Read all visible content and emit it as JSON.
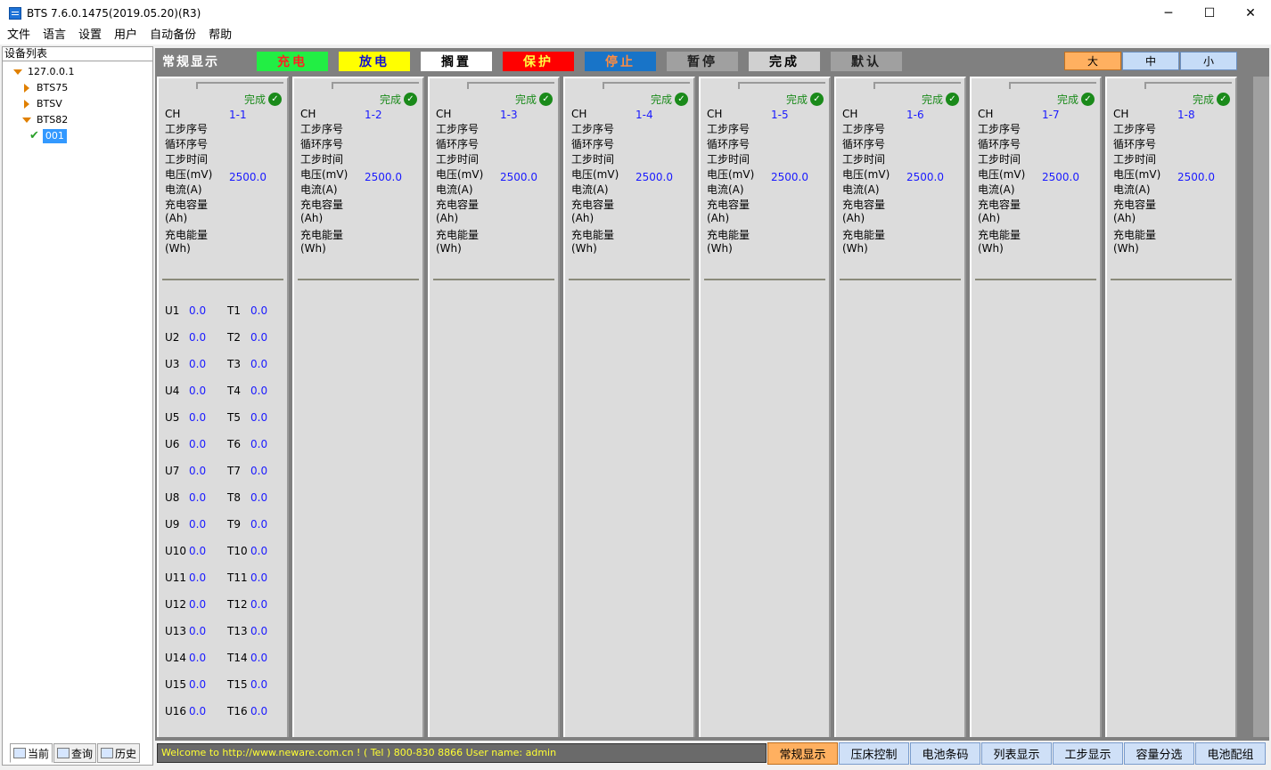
{
  "window": {
    "title": "BTS 7.6.0.1475(2019.05.20)(R3)",
    "minimize": "─",
    "maximize": "☐",
    "close": "✕"
  },
  "menu": [
    "文件",
    "语言",
    "设置",
    "用户",
    "自动备份",
    "帮助"
  ],
  "device_tree": {
    "header": "设备列表",
    "root": "127.0.0.1",
    "children": [
      "BTS75",
      "BTSV",
      "BTS82"
    ],
    "leaf": "001"
  },
  "left_tabs": [
    "当前",
    "查询",
    "历史"
  ],
  "legend": {
    "title": "常规显示",
    "items": [
      {
        "label": "充电",
        "bg": "#22ee44",
        "fg": "#ff2020"
      },
      {
        "label": "放电",
        "bg": "#ffff00",
        "fg": "#1010d0"
      },
      {
        "label": "搁置",
        "bg": "#ffffff",
        "fg": "#000000"
      },
      {
        "label": "保护",
        "bg": "#ff0000",
        "fg": "#ffff40"
      },
      {
        "label": "停止",
        "bg": "#1874c8",
        "fg": "#ff8c40"
      },
      {
        "label": "暂停",
        "bg": "#a0a0a0",
        "fg": "#202020"
      },
      {
        "label": "完成",
        "bg": "#d0d0d0",
        "fg": "#000000"
      },
      {
        "label": "默认",
        "bg": "#a0a0a0",
        "fg": "#202020"
      }
    ]
  },
  "size_buttons": {
    "large": "大",
    "medium": "中",
    "small": "小"
  },
  "channel_labels": {
    "status": "完成",
    "ch": "CH",
    "step_no": "工步序号",
    "cycle_no": "循环序号",
    "step_time": "工步时间",
    "voltage": "电压(mV)",
    "current": "电流(A)",
    "charge_cap": "充电容量",
    "charge_cap_unit": "(Ah)",
    "charge_energy": "充电能量",
    "charge_energy_unit": "(Wh)"
  },
  "channels": [
    {
      "id": "1-1",
      "voltage": "2500.0"
    },
    {
      "id": "1-2",
      "voltage": "2500.0"
    },
    {
      "id": "1-3",
      "voltage": "2500.0"
    },
    {
      "id": "1-4",
      "voltage": "2500.0"
    },
    {
      "id": "1-5",
      "voltage": "2500.0"
    },
    {
      "id": "1-6",
      "voltage": "2500.0"
    },
    {
      "id": "1-7",
      "voltage": "2500.0"
    },
    {
      "id": "1-8",
      "voltage": "2500.0"
    }
  ],
  "aux": {
    "u_labels": [
      "U1",
      "U2",
      "U3",
      "U4",
      "U5",
      "U6",
      "U7",
      "U8",
      "U9",
      "U10",
      "U11",
      "U12",
      "U13",
      "U14",
      "U15",
      "U16"
    ],
    "t_labels": [
      "T1",
      "T2",
      "T3",
      "T4",
      "T5",
      "T6",
      "T7",
      "T8",
      "T9",
      "T10",
      "T11",
      "T12",
      "T13",
      "T14",
      "T15",
      "T16"
    ],
    "u_values": [
      "0.0",
      "0.0",
      "0.0",
      "0.0",
      "0.0",
      "0.0",
      "0.0",
      "0.0",
      "0.0",
      "0.0",
      "0.0",
      "0.0",
      "0.0",
      "0.0",
      "0.0",
      "0.0"
    ],
    "t_values": [
      "0.0",
      "0.0",
      "0.0",
      "0.0",
      "0.0",
      "0.0",
      "0.0",
      "0.0",
      "0.0",
      "0.0",
      "0.0",
      "0.0",
      "0.0",
      "0.0",
      "0.0",
      "0.0"
    ]
  },
  "status_bar": {
    "message": "Welcome to http://www.neware.com.cn !    ( Tel ) 800-830 8866  User name: admin",
    "tabs": [
      "常规显示",
      "压床控制",
      "电池条码",
      "列表显示",
      "工步显示",
      "容量分选",
      "电池配组"
    ]
  }
}
